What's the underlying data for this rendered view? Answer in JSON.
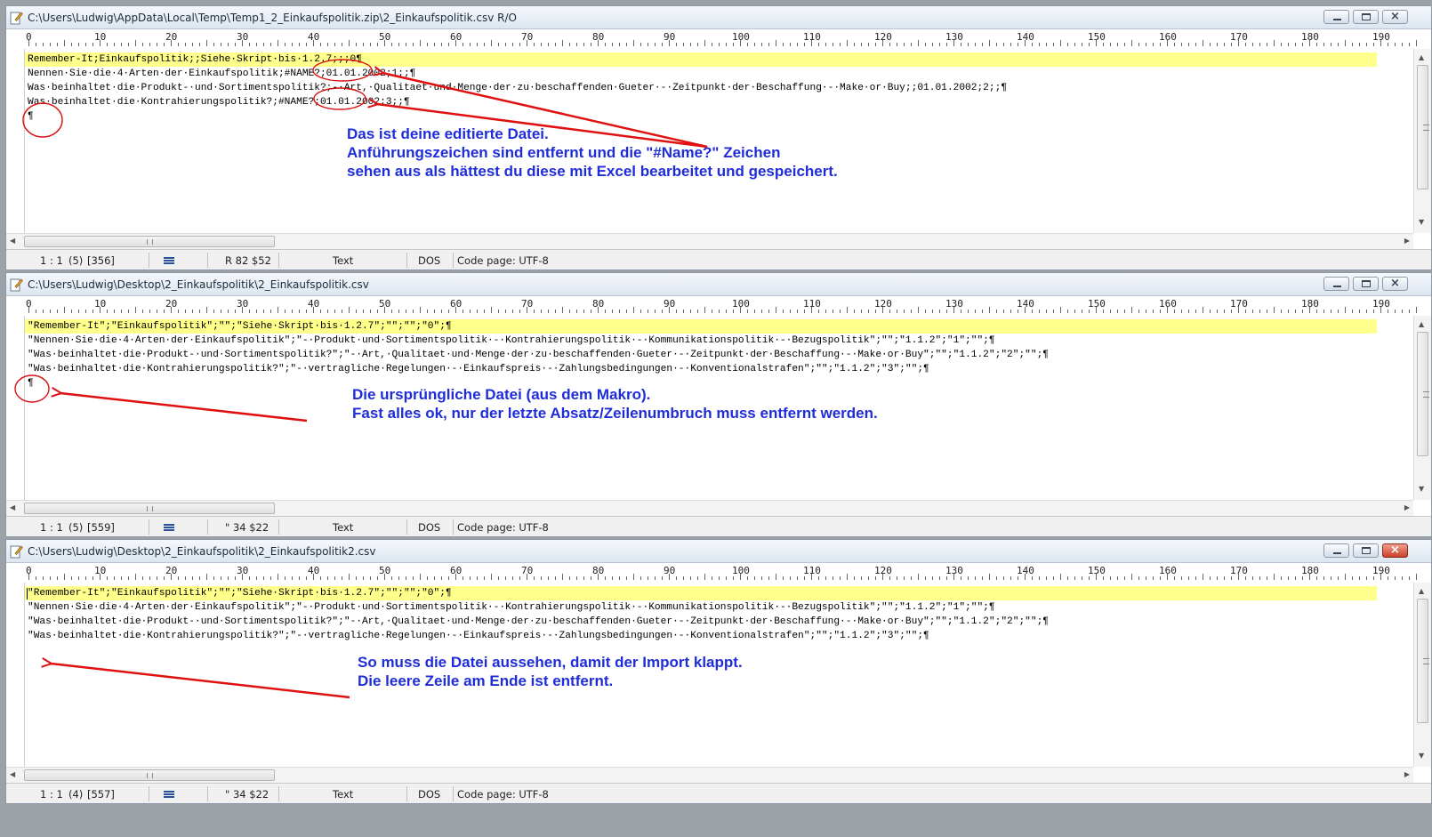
{
  "windows": [
    {
      "title": "C:\\Users\\Ludwig\\AppData\\Local\\Temp\\Temp1_2_Einkaufspolitik.zip\\2_Einkaufspolitik.csv R/O",
      "lines": [
        "Remember-It;Einkaufspolitik;;Siehe·Skript·bis·1.2.7;;;0¶",
        "Nennen·Sie·die·4·Arten·der·Einkaufspolitik;#NAME?;01.01.2002;1;;¶",
        "Was·beinhaltet·die·Produkt-·und·Sortimentspolitik?;-·Art,·Qualitaet·und·Menge·der·zu·beschaffenden·Gueter·-·Zeitpunkt·der·Beschaffung·-·Make·or·Buy;;01.01.2002;2;;¶",
        "Was·beinhaltet·die·Kontrahierungspolitik?;#NAME?;01.01.2002;3;;¶",
        "¶"
      ],
      "status": {
        "position": "1 : 1",
        "lines": "(5)",
        "bytes": "[356]",
        "char": "R  82  $52",
        "mode": "Text",
        "eol": "DOS",
        "codepage": "Code page: UTF-8"
      },
      "annotation": [
        "Das ist deine editierte Datei.",
        "Anführungszeichen sind entfernt und die \"#Name?\" Zeichen",
        "sehen aus als hättest du diese mit Excel bearbeitet und gespeichert."
      ]
    },
    {
      "title": "C:\\Users\\Ludwig\\Desktop\\2_Einkaufspolitik\\2_Einkaufspolitik.csv",
      "lines": [
        "\"Remember-It\";\"Einkaufspolitik\";\"\";\"Siehe·Skript·bis·1.2.7\";\"\";\"\";\"0\";¶",
        "\"Nennen·Sie·die·4·Arten·der·Einkaufspolitik\";\"-·Produkt·und·Sortimentspolitik·-·Kontrahierungspolitik·-·Kommunikationspolitik·-·Bezugspolitik\";\"\";\"1.1.2\";\"1\";\"\";¶",
        "\"Was·beinhaltet·die·Produkt-·und·Sortimentspolitik?\";\"-·Art,·Qualitaet·und·Menge·der·zu·beschaffenden·Gueter·-·Zeitpunkt·der·Beschaffung·-·Make·or·Buy\";\"\";\"1.1.2\";\"2\";\"\";¶",
        "\"Was·beinhaltet·die·Kontrahierungspolitik?\";\"-·vertragliche·Regelungen·-·Einkaufspreis·-·Zahlungsbedingungen·-·Konventionalstrafen\";\"\";\"1.1.2\";\"3\";\"\";¶",
        "¶"
      ],
      "status": {
        "position": "1 : 1",
        "lines": "(5)",
        "bytes": "[559]",
        "char": "\"  34  $22",
        "mode": "Text",
        "eol": "DOS",
        "codepage": "Code page: UTF-8"
      },
      "annotation": [
        "Die ursprüngliche Datei (aus dem Makro).",
        "Fast alles ok, nur der letzte Absatz/Zeilenumbruch muss entfernt werden."
      ]
    },
    {
      "title": "C:\\Users\\Ludwig\\Desktop\\2_Einkaufspolitik\\2_Einkaufspolitik2.csv",
      "lines": [
        "\"Remember-It\";\"Einkaufspolitik\";\"\";\"Siehe·Skript·bis·1.2.7\";\"\";\"\";\"0\";¶",
        "\"Nennen·Sie·die·4·Arten·der·Einkaufspolitik\";\"-·Produkt·und·Sortimentspolitik·-·Kontrahierungspolitik·-·Kommunikationspolitik·-·Bezugspolitik\";\"\";\"1.1.2\";\"1\";\"\";¶",
        "\"Was·beinhaltet·die·Produkt-·und·Sortimentspolitik?\";\"-·Art,·Qualitaet·und·Menge·der·zu·beschaffenden·Gueter·-·Zeitpunkt·der·Beschaffung·-·Make·or·Buy\";\"\";\"1.1.2\";\"2\";\"\";¶",
        "\"Was·beinhaltet·die·Kontrahierungspolitik?\";\"-·vertragliche·Regelungen·-·Einkaufspreis·-·Zahlungsbedingungen·-·Konventionalstrafen\";\"\";\"1.1.2\";\"3\";\"\";¶"
      ],
      "status": {
        "position": "1 : 1",
        "lines": "(4)",
        "bytes": "[557]",
        "char": "\"  34  $22",
        "mode": "Text",
        "eol": "DOS",
        "codepage": "Code page: UTF-8"
      },
      "annotation": [
        "So muss die Datei aussehen, damit der Import klappt.",
        "Die leere Zeile am Ende ist entfernt."
      ]
    }
  ],
  "ruler_labels": [
    "0",
    "10",
    "20",
    "30",
    "40",
    "50",
    "60",
    "70",
    "80",
    "90",
    "100",
    "110",
    "120",
    "130",
    "140",
    "150",
    "160",
    "170",
    "180",
    "190"
  ],
  "colors": {
    "annotation": "#1f2dd8",
    "arrow": "#e01010",
    "current_line": "#ffff8c"
  }
}
